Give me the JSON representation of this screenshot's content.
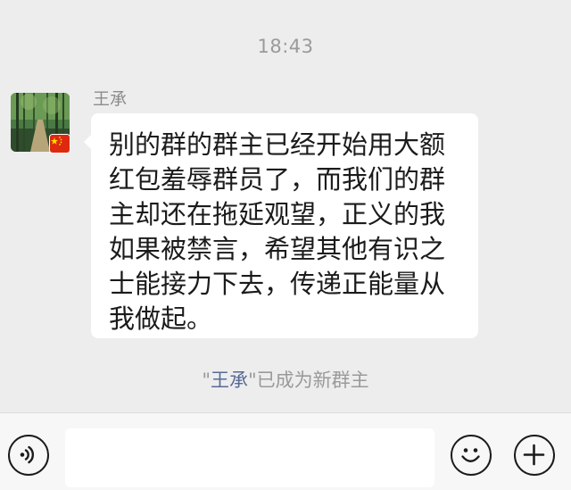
{
  "timestamp": "18:43",
  "message": {
    "sender_name": "王承",
    "lines": [
      "别的群的群主已经开始用大额",
      "红包羞辱群员了，而我们的群",
      "主却还在拖延观望，正义的我",
      "如果被禁言，希望其他有识之",
      "士能接力下去，传递正能量从",
      "我做起。"
    ],
    "avatar_icon": "bamboo-forest-avatar",
    "badge_icon": "china-flag-icon"
  },
  "system_notice": {
    "prefix": "\"",
    "name": "王承",
    "suffix": "\"已成为新群主"
  },
  "input_bar": {
    "voice_icon": "voice-icon",
    "emoji_icon": "emoji-icon",
    "plus_icon": "plus-icon",
    "input_value": ""
  },
  "colors": {
    "background": "#ededed",
    "bubble": "#ffffff",
    "name_link": "#576b95",
    "muted_text": "#9a9a9a"
  }
}
